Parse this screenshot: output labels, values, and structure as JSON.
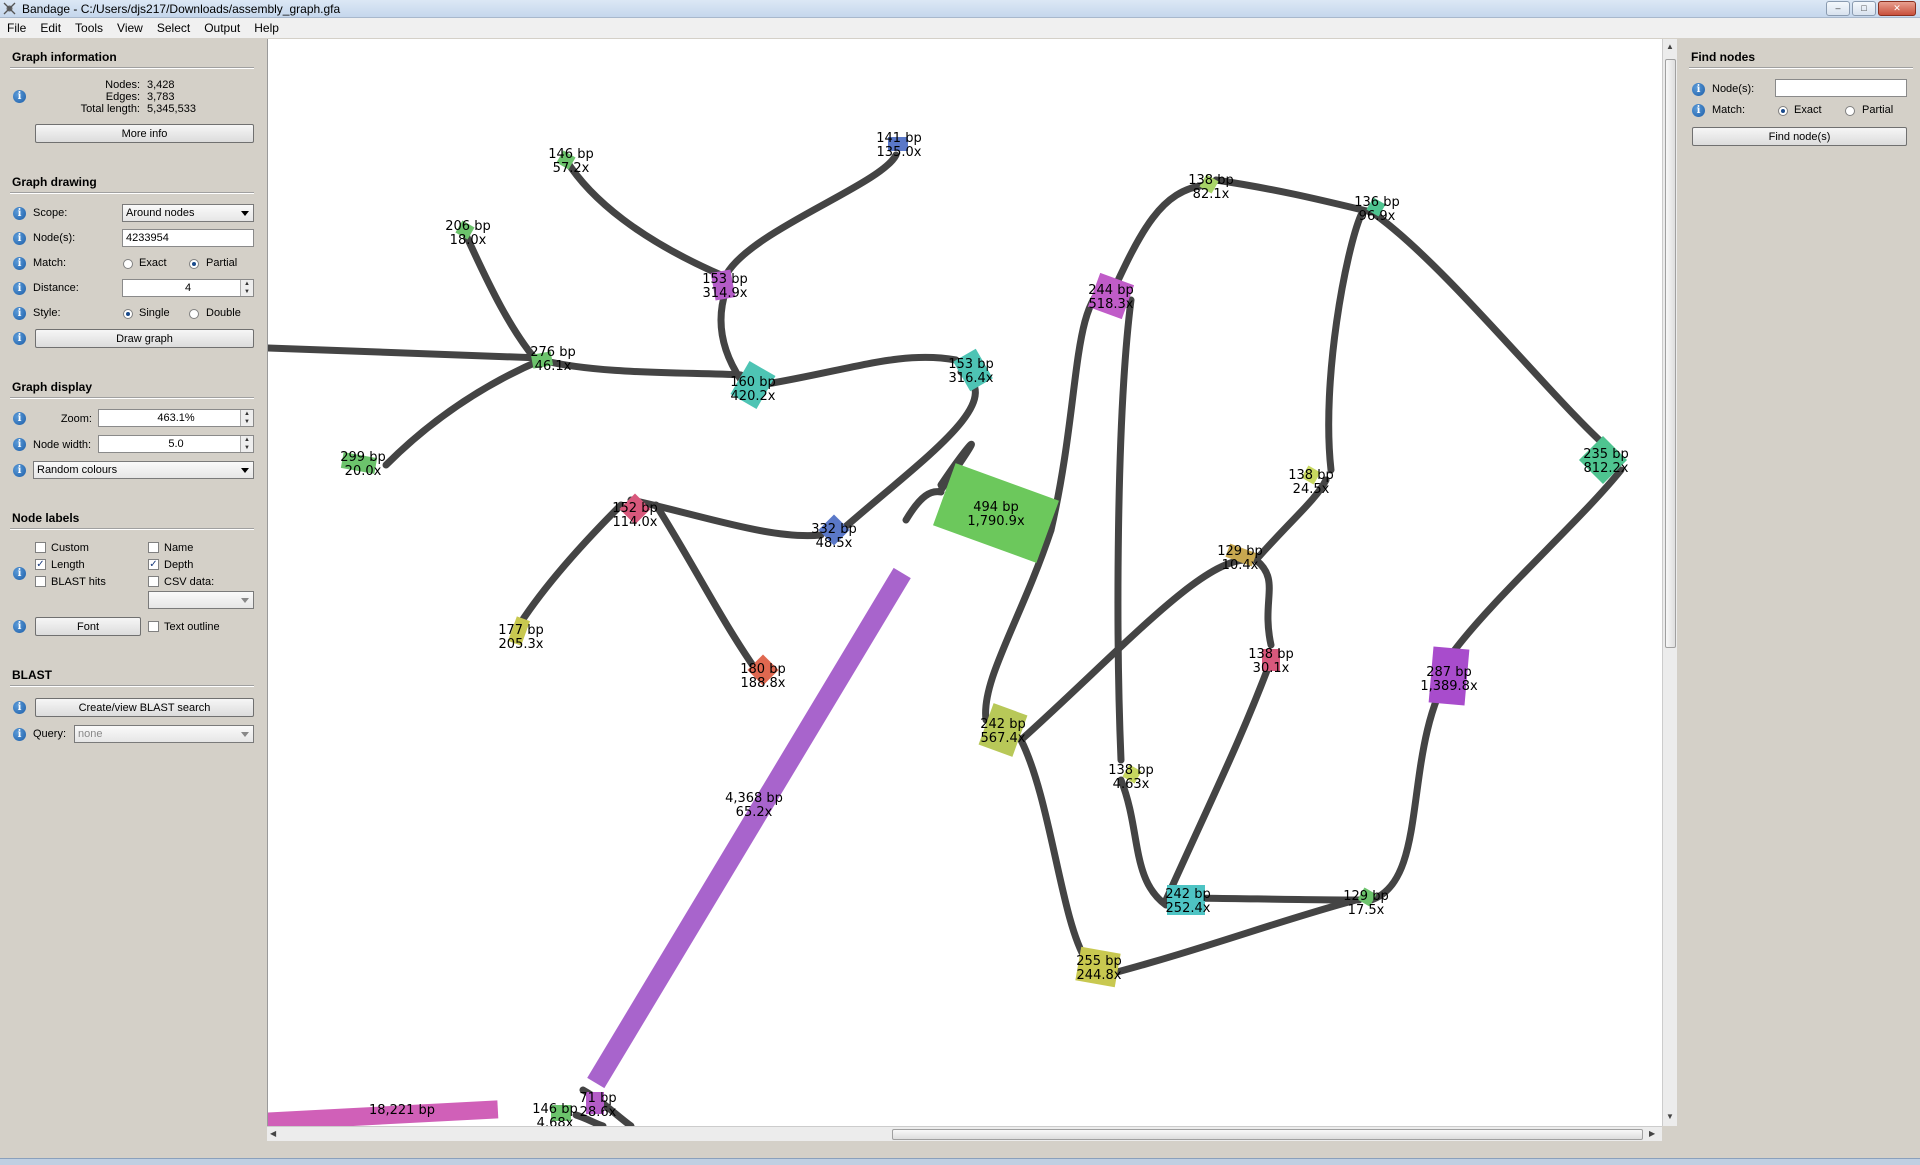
{
  "window": {
    "title": "Bandage - C:/Users/djs217/Downloads/assembly_graph.gfa",
    "buttons": [
      "–",
      "□",
      "✕"
    ]
  },
  "menu": [
    "File",
    "Edit",
    "Tools",
    "View",
    "Select",
    "Output",
    "Help"
  ],
  "left_panel": {
    "graph_information": {
      "title": "Graph information",
      "nodes_label": "Nodes:",
      "nodes_value": "3,428",
      "edges_label": "Edges:",
      "edges_value": "3,783",
      "length_label": "Total length:",
      "length_value": "5,345,533",
      "more_info": "More info"
    },
    "graph_drawing": {
      "title": "Graph drawing",
      "scope_label": "Scope:",
      "scope_value": "Around nodes",
      "nodes_label": "Node(s):",
      "nodes_value": "4233954",
      "match_label": "Match:",
      "match_exact": "Exact",
      "match_partial": "Partial",
      "distance_label": "Distance:",
      "distance_value": "4",
      "style_label": "Style:",
      "style_single": "Single",
      "style_double": "Double",
      "draw_graph": "Draw graph"
    },
    "graph_display": {
      "title": "Graph display",
      "zoom_label": "Zoom:",
      "zoom_value": "463.1%",
      "node_width_label": "Node width:",
      "node_width_value": "5.0",
      "colour_scheme": "Random colours"
    },
    "node_labels": {
      "title": "Node labels",
      "custom": "Custom",
      "name": "Name",
      "length": "Length",
      "depth": "Depth",
      "blast_hits": "BLAST hits",
      "csv_data": "CSV data:",
      "font": "Font",
      "text_outline": "Text outline"
    },
    "blast": {
      "title": "BLAST",
      "create_search": "Create/view BLAST search",
      "query_label": "Query:",
      "query_value": "none"
    }
  },
  "right_panel": {
    "title": "Find nodes",
    "nodes_label": "Node(s):",
    "match_label": "Match:",
    "match_exact": "Exact",
    "match_partial": "Partial",
    "find_button": "Find node(s)"
  },
  "graph": {
    "edge_color": "#444444",
    "nodes": [
      {
        "length": "146 bp",
        "depth": "57.2x",
        "color": "#6cc36c"
      },
      {
        "length": "141 bp",
        "depth": "135.0x",
        "color": "#5a78c8"
      },
      {
        "length": "206 bp",
        "depth": "18.0x",
        "color": "#6cc36c"
      },
      {
        "length": "153 bp",
        "depth": "314.9x",
        "color": "#b45cc8"
      },
      {
        "length": "276 bp",
        "depth": "46.1x",
        "color": "#6cc36c"
      },
      {
        "length": "160 bp",
        "depth": "420.2x",
        "color": "#4ec4b4"
      },
      {
        "length": "153 bp",
        "depth": "316.4x",
        "color": "#4ec4b4"
      },
      {
        "length": "299 bp",
        "depth": "20.0x",
        "color": "#6cc36c"
      },
      {
        "length": "152 bp",
        "depth": "114.0x",
        "color": "#d8587c"
      },
      {
        "length": "332 bp",
        "depth": "48.5x",
        "color": "#5a78c8"
      },
      {
        "length": "177 bp",
        "depth": "205.3x",
        "color": "#c8c850"
      },
      {
        "length": "180 bp",
        "depth": "188.8x",
        "color": "#e06850"
      },
      {
        "length": "494 bp",
        "depth": "1,790.9x",
        "color": "#6cc85c"
      },
      {
        "length": "4,368 bp",
        "depth": "65.2x",
        "color": "#a864cc"
      },
      {
        "length": "18,221 bp",
        "depth": "",
        "color": "#d060b8"
      },
      {
        "length": "146 bp",
        "depth": "4.68x",
        "color": "#6cc36c"
      },
      {
        "length": "71 bp",
        "depth": "28.6x",
        "color": "#b45cc8"
      },
      {
        "length": "138 bp",
        "depth": "82.1x",
        "color": "#a8d468"
      },
      {
        "length": "136 bp",
        "depth": "96.9x",
        "color": "#4ec490"
      },
      {
        "length": "244 bp",
        "depth": "518.3x",
        "color": "#c05cc8"
      },
      {
        "length": "138 bp",
        "depth": "24.5x",
        "color": "#c8d860"
      },
      {
        "length": "235 bp",
        "depth": "812.2x",
        "color": "#4ec490"
      },
      {
        "length": "129 bp",
        "depth": "10.4x",
        "color": "#c8a850"
      },
      {
        "length": "138 bp",
        "depth": "30.1x",
        "color": "#d8587c"
      },
      {
        "length": "287 bp",
        "depth": "1,389.8x",
        "color": "#a84ccc"
      },
      {
        "length": "242 bp",
        "depth": "567.4x",
        "color": "#b8c858"
      },
      {
        "length": "138 bp",
        "depth": "4.63x",
        "color": "#c8d860"
      },
      {
        "length": "242 bp",
        "depth": "252.4x",
        "color": "#4ec4c4"
      },
      {
        "length": "129 bp",
        "depth": "17.5x",
        "color": "#6cc36c"
      },
      {
        "length": "255 bp",
        "depth": "244.8x",
        "color": "#c8c850"
      }
    ]
  }
}
